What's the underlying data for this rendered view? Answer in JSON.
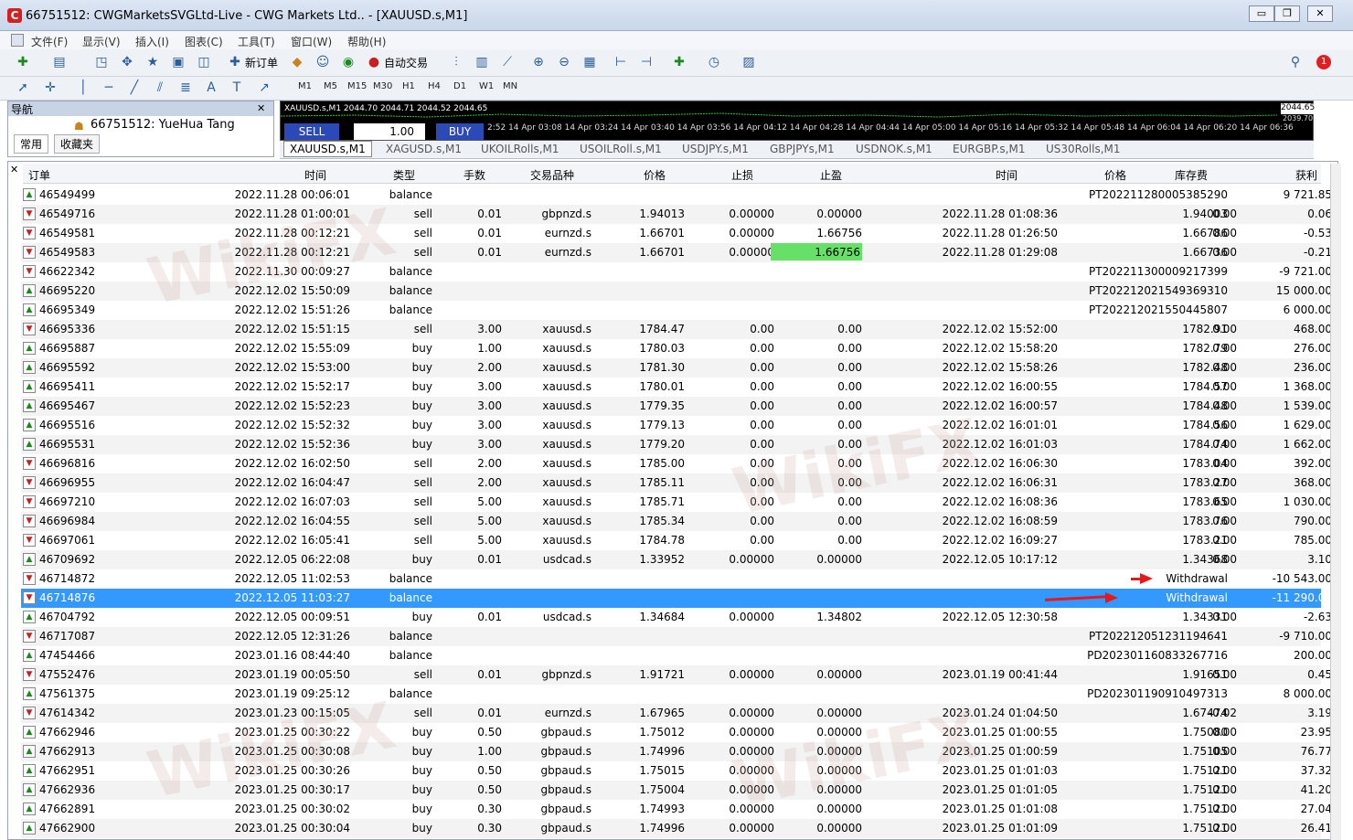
{
  "window": {
    "title": "66751512: CWGMarketsSVGLtd-Live - CWG Markets Ltd.. - [XAUUSD.s,M1]",
    "icon_letter": "C",
    "controls": [
      "▭",
      "❐",
      "✕"
    ]
  },
  "menu": [
    "文件(F)",
    "显示(V)",
    "插入(I)",
    "图表(C)",
    "工具(T)",
    "窗口(W)",
    "帮助(H)"
  ],
  "toolbar": {
    "new_order_label": "新订单",
    "auto_trade_label": "自动交易",
    "timeframes": [
      "M1",
      "M5",
      "M15",
      "M30",
      "H1",
      "H4",
      "D1",
      "W1",
      "MN"
    ],
    "notification_count": "1"
  },
  "navigator": {
    "title": "导航",
    "account": "66751512: YueHua Tang",
    "tabs": [
      "常用",
      "收藏夹"
    ]
  },
  "chart": {
    "title": "XAUUSD.s,M1  2044.70 2044.71 2044.52 2044.65",
    "sell_label": "SELL",
    "buy_label": "BUY",
    "lot": "1.00",
    "times": "2:52   14 Apr 03:08   14 Apr 03:24   14 Apr 03:40   14 Apr 03:56   14 Apr 04:12   14 Apr 04:28   14 Apr 04:44   14 Apr 05:00   14 Apr 05:16   14 Apr 05:32   14 Apr 05:48   14 Apr 06:04   14 Apr 06:20   14 Apr 06:36",
    "price_tag": "2044.65",
    "price_tag2": "2039.70"
  },
  "symbol_tabs": [
    "XAUUSD.s,M1",
    "XAGUSD.s,M1",
    "UKOILRolls,M1",
    "USOILRoll.s,M1",
    "USDJPY.s,M1",
    "GBPJPYs,M1",
    "USDNOK.s,M1",
    "EURGBP.s,M1",
    "US30Rolls,M1"
  ],
  "table": {
    "headers": [
      "订单",
      "时间",
      "类型",
      "手数",
      "交易品种",
      "价格",
      "止损",
      "止盈",
      "时间",
      "价格",
      "库存费",
      "获利"
    ],
    "rows": [
      {
        "order": "46549499",
        "time": "2022.11.28 00:06:01",
        "type": "balance",
        "lots": "",
        "symbol": "",
        "price": "",
        "sl": "",
        "tp": "",
        "ctime": "",
        "cprice": "PT202211280005385290",
        "swap": "",
        "profit": "9 721.85",
        "icon": "+"
      },
      {
        "order": "46549716",
        "time": "2022.11.28 01:00:01",
        "type": "sell",
        "lots": "0.01",
        "symbol": "gbpnzd.s",
        "price": "1.94013",
        "sl": "0.00000",
        "tp": "0.00000",
        "ctime": "2022.11.28 01:08:36",
        "cprice": "1.94003",
        "swap": "0.00",
        "profit": "0.06",
        "icon": "s"
      },
      {
        "order": "46549581",
        "time": "2022.11.28 00:12:21",
        "type": "sell",
        "lots": "0.01",
        "symbol": "eurnzd.s",
        "price": "1.66701",
        "sl": "0.00000",
        "tp": "1.66756",
        "ctime": "2022.11.28 01:26:50",
        "cprice": "1.66786",
        "swap": "0.00",
        "profit": "-0.53",
        "icon": "s"
      },
      {
        "order": "46549583",
        "time": "2022.11.28 00:12:21",
        "type": "sell",
        "lots": "0.01",
        "symbol": "eurnzd.s",
        "price": "1.66701",
        "sl": "0.00000",
        "tp": "1.66756",
        "ctime": "2022.11.28 01:29:08",
        "cprice": "1.66736",
        "swap": "0.00",
        "profit": "-0.21",
        "icon": "s",
        "tp_highlight": true
      },
      {
        "order": "46622342",
        "time": "2022.11.30 00:09:27",
        "type": "balance",
        "lots": "",
        "symbol": "",
        "price": "",
        "sl": "",
        "tp": "",
        "ctime": "",
        "cprice": "PT202211300009217399",
        "swap": "",
        "profit": "-9 721.00",
        "icon": "-"
      },
      {
        "order": "46695220",
        "time": "2022.12.02 15:50:09",
        "type": "balance",
        "lots": "",
        "symbol": "",
        "price": "",
        "sl": "",
        "tp": "",
        "ctime": "",
        "cprice": "PT202212021549369310",
        "swap": "",
        "profit": "15 000.00",
        "icon": "+"
      },
      {
        "order": "46695349",
        "time": "2022.12.02 15:51:26",
        "type": "balance",
        "lots": "",
        "symbol": "",
        "price": "",
        "sl": "",
        "tp": "",
        "ctime": "",
        "cprice": "PT202212021550445807",
        "swap": "",
        "profit": "6 000.00",
        "icon": "+"
      },
      {
        "order": "46695336",
        "time": "2022.12.02 15:51:15",
        "type": "sell",
        "lots": "3.00",
        "symbol": "xauusd.s",
        "price": "1784.47",
        "sl": "0.00",
        "tp": "0.00",
        "ctime": "2022.12.02 15:52:00",
        "cprice": "1782.91",
        "swap": "0.00",
        "profit": "468.00",
        "icon": "s"
      },
      {
        "order": "46695887",
        "time": "2022.12.02 15:55:09",
        "type": "buy",
        "lots": "1.00",
        "symbol": "xauusd.s",
        "price": "1780.03",
        "sl": "0.00",
        "tp": "0.00",
        "ctime": "2022.12.02 15:58:20",
        "cprice": "1782.79",
        "swap": "0.00",
        "profit": "276.00",
        "icon": "b"
      },
      {
        "order": "46695592",
        "time": "2022.12.02 15:53:00",
        "type": "buy",
        "lots": "2.00",
        "symbol": "xauusd.s",
        "price": "1781.30",
        "sl": "0.00",
        "tp": "0.00",
        "ctime": "2022.12.02 15:58:26",
        "cprice": "1782.48",
        "swap": "0.00",
        "profit": "236.00",
        "icon": "b"
      },
      {
        "order": "46695411",
        "time": "2022.12.02 15:52:17",
        "type": "buy",
        "lots": "3.00",
        "symbol": "xauusd.s",
        "price": "1780.01",
        "sl": "0.00",
        "tp": "0.00",
        "ctime": "2022.12.02 16:00:55",
        "cprice": "1784.57",
        "swap": "0.00",
        "profit": "1 368.00",
        "icon": "b"
      },
      {
        "order": "46695467",
        "time": "2022.12.02 15:52:23",
        "type": "buy",
        "lots": "3.00",
        "symbol": "xauusd.s",
        "price": "1779.35",
        "sl": "0.00",
        "tp": "0.00",
        "ctime": "2022.12.02 16:00:57",
        "cprice": "1784.48",
        "swap": "0.00",
        "profit": "1 539.00",
        "icon": "b"
      },
      {
        "order": "46695516",
        "time": "2022.12.02 15:52:32",
        "type": "buy",
        "lots": "3.00",
        "symbol": "xauusd.s",
        "price": "1779.13",
        "sl": "0.00",
        "tp": "0.00",
        "ctime": "2022.12.02 16:01:01",
        "cprice": "1784.56",
        "swap": "0.00",
        "profit": "1 629.00",
        "icon": "b"
      },
      {
        "order": "46695531",
        "time": "2022.12.02 15:52:36",
        "type": "buy",
        "lots": "3.00",
        "symbol": "xauusd.s",
        "price": "1779.20",
        "sl": "0.00",
        "tp": "0.00",
        "ctime": "2022.12.02 16:01:03",
        "cprice": "1784.74",
        "swap": "0.00",
        "profit": "1 662.00",
        "icon": "b"
      },
      {
        "order": "46696816",
        "time": "2022.12.02 16:02:50",
        "type": "sell",
        "lots": "2.00",
        "symbol": "xauusd.s",
        "price": "1785.00",
        "sl": "0.00",
        "tp": "0.00",
        "ctime": "2022.12.02 16:06:30",
        "cprice": "1783.04",
        "swap": "0.00",
        "profit": "392.00",
        "icon": "s"
      },
      {
        "order": "46696955",
        "time": "2022.12.02 16:04:47",
        "type": "sell",
        "lots": "2.00",
        "symbol": "xauusd.s",
        "price": "1785.11",
        "sl": "0.00",
        "tp": "0.00",
        "ctime": "2022.12.02 16:06:31",
        "cprice": "1783.27",
        "swap": "0.00",
        "profit": "368.00",
        "icon": "s"
      },
      {
        "order": "46697210",
        "time": "2022.12.02 16:07:03",
        "type": "sell",
        "lots": "5.00",
        "symbol": "xauusd.s",
        "price": "1785.71",
        "sl": "0.00",
        "tp": "0.00",
        "ctime": "2022.12.02 16:08:36",
        "cprice": "1783.65",
        "swap": "0.00",
        "profit": "1 030.00",
        "icon": "s"
      },
      {
        "order": "46696984",
        "time": "2022.12.02 16:04:55",
        "type": "sell",
        "lots": "5.00",
        "symbol": "xauusd.s",
        "price": "1785.34",
        "sl": "0.00",
        "tp": "0.00",
        "ctime": "2022.12.02 16:08:59",
        "cprice": "1783.76",
        "swap": "0.00",
        "profit": "790.00",
        "icon": "s"
      },
      {
        "order": "46697061",
        "time": "2022.12.02 16:05:41",
        "type": "sell",
        "lots": "5.00",
        "symbol": "xauusd.s",
        "price": "1784.78",
        "sl": "0.00",
        "tp": "0.00",
        "ctime": "2022.12.02 16:09:27",
        "cprice": "1783.21",
        "swap": "0.00",
        "profit": "785.00",
        "icon": "s"
      },
      {
        "order": "46709692",
        "time": "2022.12.05 06:22:08",
        "type": "buy",
        "lots": "0.01",
        "symbol": "usdcad.s",
        "price": "1.33952",
        "sl": "0.00000",
        "tp": "0.00000",
        "ctime": "2022.12.05 10:17:12",
        "cprice": "1.34368",
        "swap": "0.00",
        "profit": "3.10",
        "icon": "b"
      },
      {
        "order": "46714872",
        "time": "2022.12.05 11:02:53",
        "type": "balance",
        "lots": "",
        "symbol": "",
        "price": "",
        "sl": "",
        "tp": "",
        "ctime": "",
        "cprice": "Withdrawal",
        "swap": "",
        "profit": "-10 543.00",
        "icon": "-",
        "arrow": "short"
      },
      {
        "order": "46714876",
        "time": "2022.12.05 11:03:27",
        "type": "balance",
        "lots": "",
        "symbol": "",
        "price": "",
        "sl": "",
        "tp": "",
        "ctime": "",
        "cprice": "Withdrawal",
        "swap": "",
        "profit": "-11 290.00",
        "icon": "-",
        "selected": true,
        "arrow": "long"
      },
      {
        "order": "46704792",
        "time": "2022.12.05 00:09:51",
        "type": "buy",
        "lots": "0.01",
        "symbol": "usdcad.s",
        "price": "1.34684",
        "sl": "0.00000",
        "tp": "1.34802",
        "ctime": "2022.12.05 12:30:58",
        "cprice": "1.34331",
        "swap": "0.00",
        "profit": "-2.63",
        "icon": "b"
      },
      {
        "order": "46717087",
        "time": "2022.12.05 12:31:26",
        "type": "balance",
        "lots": "",
        "symbol": "",
        "price": "",
        "sl": "",
        "tp": "",
        "ctime": "",
        "cprice": "PT202212051231194641",
        "swap": "",
        "profit": "-9 710.00",
        "icon": "-"
      },
      {
        "order": "47454466",
        "time": "2023.01.16 08:44:40",
        "type": "balance",
        "lots": "",
        "symbol": "",
        "price": "",
        "sl": "",
        "tp": "",
        "ctime": "",
        "cprice": "PD202301160833267716",
        "swap": "",
        "profit": "200.00",
        "icon": "+"
      },
      {
        "order": "47552476",
        "time": "2023.01.19 00:05:50",
        "type": "sell",
        "lots": "0.01",
        "symbol": "gbpnzd.s",
        "price": "1.91721",
        "sl": "0.00000",
        "tp": "0.00000",
        "ctime": "2023.01.19 00:41:44",
        "cprice": "1.91651",
        "swap": "0.00",
        "profit": "0.45",
        "icon": "s"
      },
      {
        "order": "47561375",
        "time": "2023.01.19 09:25:12",
        "type": "balance",
        "lots": "",
        "symbol": "",
        "price": "",
        "sl": "",
        "tp": "",
        "ctime": "",
        "cprice": "PD202301190910497313",
        "swap": "",
        "profit": "8 000.00",
        "icon": "+"
      },
      {
        "order": "47614342",
        "time": "2023.01.23 00:15:05",
        "type": "sell",
        "lots": "0.01",
        "symbol": "eurnzd.s",
        "price": "1.67965",
        "sl": "0.00000",
        "tp": "0.00000",
        "ctime": "2023.01.24 01:04:50",
        "cprice": "1.67474",
        "swap": "-0.02",
        "profit": "3.19",
        "icon": "s"
      },
      {
        "order": "47662946",
        "time": "2023.01.25 00:30:22",
        "type": "buy",
        "lots": "0.50",
        "symbol": "gbpaud.s",
        "price": "1.75012",
        "sl": "0.00000",
        "tp": "0.00000",
        "ctime": "2023.01.25 01:00:55",
        "cprice": "1.75080",
        "swap": "0.00",
        "profit": "23.95",
        "icon": "b"
      },
      {
        "order": "47662913",
        "time": "2023.01.25 00:30:08",
        "type": "buy",
        "lots": "1.00",
        "symbol": "gbpaud.s",
        "price": "1.74996",
        "sl": "0.00000",
        "tp": "0.00000",
        "ctime": "2023.01.25 01:00:59",
        "cprice": "1.75105",
        "swap": "0.00",
        "profit": "76.77",
        "icon": "b"
      },
      {
        "order": "47662951",
        "time": "2023.01.25 00:30:26",
        "type": "buy",
        "lots": "0.50",
        "symbol": "gbpaud.s",
        "price": "1.75015",
        "sl": "0.00000",
        "tp": "0.00000",
        "ctime": "2023.01.25 01:01:03",
        "cprice": "1.75121",
        "swap": "0.00",
        "profit": "37.32",
        "icon": "b"
      },
      {
        "order": "47662936",
        "time": "2023.01.25 00:30:17",
        "type": "buy",
        "lots": "0.50",
        "symbol": "gbpaud.s",
        "price": "1.75004",
        "sl": "0.00000",
        "tp": "0.00000",
        "ctime": "2023.01.25 01:01:05",
        "cprice": "1.75121",
        "swap": "0.00",
        "profit": "41.20",
        "icon": "b"
      },
      {
        "order": "47662891",
        "time": "2023.01.25 00:30:02",
        "type": "buy",
        "lots": "0.30",
        "symbol": "gbpaud.s",
        "price": "1.74993",
        "sl": "0.00000",
        "tp": "0.00000",
        "ctime": "2023.01.25 01:01:08",
        "cprice": "1.75121",
        "swap": "0.00",
        "profit": "27.04",
        "icon": "b"
      },
      {
        "order": "47662900",
        "time": "2023.01.25 00:30:04",
        "type": "buy",
        "lots": "0.30",
        "symbol": "gbpaud.s",
        "price": "1.74996",
        "sl": "0.00000",
        "tp": "0.00000",
        "ctime": "2023.01.25 01:01:09",
        "cprice": "1.75121",
        "swap": "0.00",
        "profit": "26.41",
        "icon": "b"
      }
    ]
  },
  "colors": {
    "selection": "#3399ff",
    "tp_highlight": "#66e066",
    "arrow": "#e81818",
    "trade_button": "#2b4ab8"
  }
}
